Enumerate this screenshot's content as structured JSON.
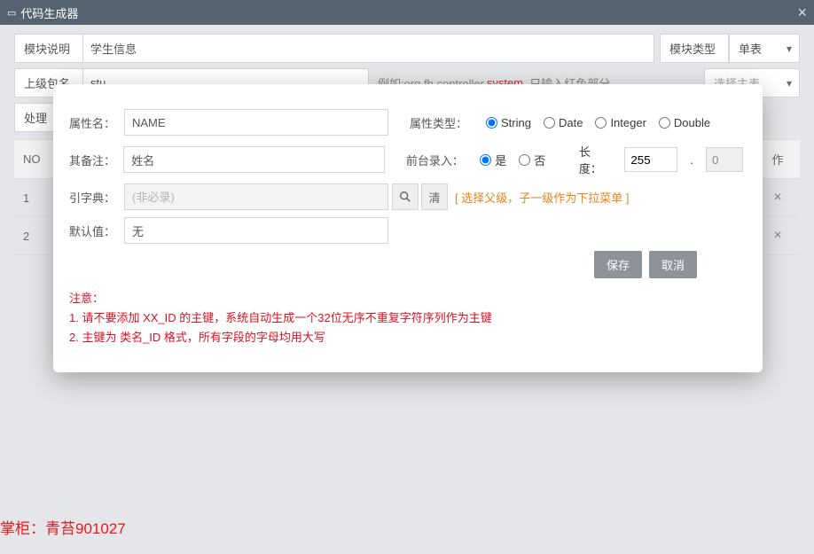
{
  "titlebar": {
    "icon": "▭",
    "title": "代码生成器"
  },
  "form": {
    "module_desc_label": "模块说明",
    "module_desc_value": "学生信息",
    "module_type_label": "模块类型",
    "module_type_value": "单表",
    "parent_pkg_label": "上级包名",
    "parent_pkg_value": "stu",
    "pkg_hint_prefix": "例如:org.fh.controller.",
    "pkg_hint_hl": "system",
    "pkg_hint_suffix": ", 只输入红色部分",
    "select_master_label": "选择主表",
    "handle_label": "处理"
  },
  "table": {
    "headers": {
      "no": "NO",
      "action": "作"
    },
    "rows": [
      {
        "no": "1"
      },
      {
        "no": "2"
      }
    ]
  },
  "modal": {
    "attr_name_label": "属性名：",
    "attr_name_value": "NAME",
    "remark_label": "其备注：",
    "remark_value": "姓名",
    "dict_label": "引字典：",
    "dict_placeholder": "(非必录)",
    "default_label": "默认值：",
    "default_value": "无",
    "attr_type_label": "属性类型：",
    "types": {
      "string": "String",
      "date": "Date",
      "integer": "Integer",
      "double": "Double"
    },
    "front_input_label": "前台录入：",
    "yes": "是",
    "no": "否",
    "length_label": "长度：",
    "length_value": "255",
    "length_dec": "0",
    "select_parent_hint": "[ 选择父级，子一级作为下拉菜单 ]",
    "clear_label": "清",
    "save": "保存",
    "cancel": "取消",
    "note_title": "注意：",
    "note1": "1. 请不要添加 XX_ID 的主键，系统自动生成一个32位无序不重复字符序列作为主键",
    "note2": "2. 主键为 类名_ID 格式，所有字段的字母均用大写"
  },
  "footer": "掌柜：青苔901027"
}
